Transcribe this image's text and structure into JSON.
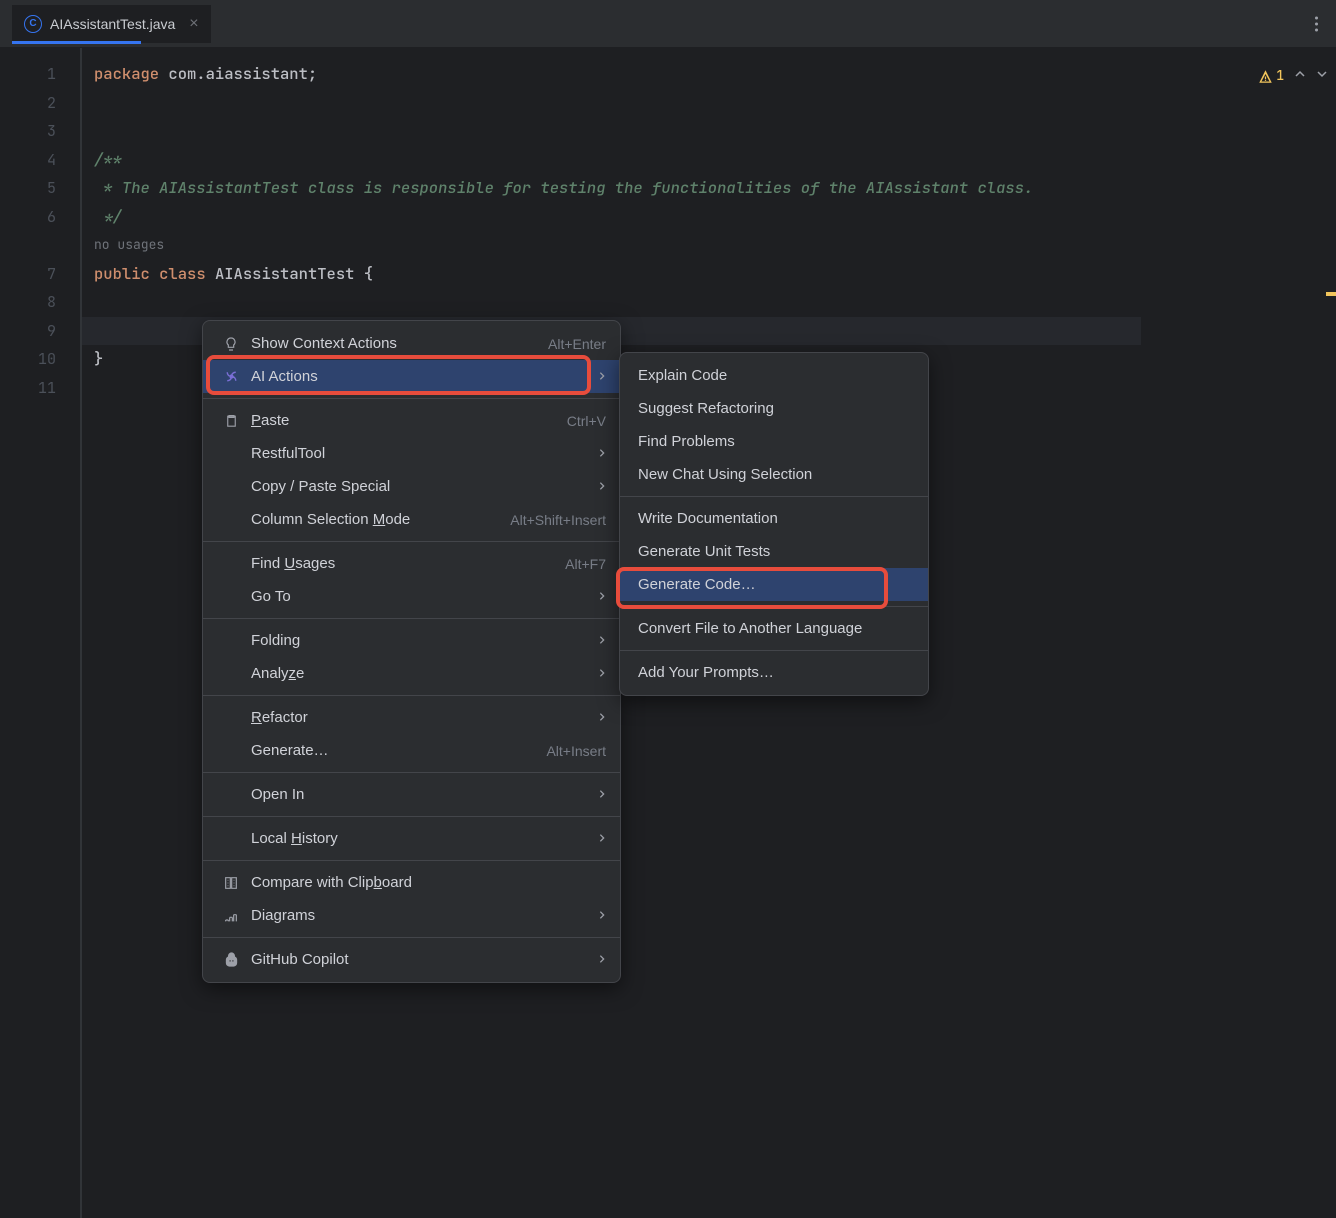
{
  "tab": {
    "name": "AIAssistantTest.java"
  },
  "status": {
    "warnings": "1"
  },
  "code": {
    "line1_kw": "package",
    "line1_rest": " com.aiassistant;",
    "line4": "/**",
    "line5": " * The AIAssistantTest class is responsible for testing the functionalities of the AIAssistant class.",
    "line6": " */",
    "usages": "no usages",
    "line7_kw1": "public",
    "line7_kw2": "class",
    "line7_name": "AIAssistantTest",
    "line7_brace": " {",
    "line10": "}"
  },
  "lineNumbers": [
    "1",
    "2",
    "3",
    "4",
    "5",
    "6",
    "",
    "7",
    "8",
    "9",
    "10",
    "11"
  ],
  "menu1": {
    "items": [
      {
        "icon": "bulb",
        "label": "Show Context Actions",
        "shortcut": "Alt+Enter"
      },
      {
        "icon": "spiral",
        "label": "AI Actions",
        "arrow": true,
        "hovered": true
      },
      "sep",
      {
        "icon": "clipboard",
        "label_pre": "",
        "underline": "P",
        "label_post": "aste",
        "shortcut": "Ctrl+V"
      },
      {
        "label": "RestfulTool",
        "arrow": true
      },
      {
        "label": "Copy / Paste Special",
        "arrow": true
      },
      {
        "label_pre": "Column Selection ",
        "underline": "M",
        "label_post": "ode",
        "shortcut": "Alt+Shift+Insert"
      },
      "sep",
      {
        "label_pre": "Find ",
        "underline": "U",
        "label_post": "sages",
        "shortcut": "Alt+F7"
      },
      {
        "label": "Go To",
        "arrow": true
      },
      "sep",
      {
        "label": "Folding",
        "arrow": true
      },
      {
        "label_pre": "Analy",
        "underline": "z",
        "label_post": "e",
        "arrow": true
      },
      "sep",
      {
        "label_pre": "",
        "underline": "R",
        "label_post": "efactor",
        "arrow": true
      },
      {
        "label": "Generate…",
        "shortcut": "Alt+Insert"
      },
      "sep",
      {
        "label": "Open In",
        "arrow": true
      },
      "sep",
      {
        "label_pre": "Local ",
        "underline": "H",
        "label_post": "istory",
        "arrow": true
      },
      "sep",
      {
        "icon": "compare",
        "label_pre": "Compare with Clip",
        "underline": "b",
        "label_post": "oard"
      },
      {
        "icon": "diagram",
        "label": "Diagrams",
        "arrow": true
      },
      "sep",
      {
        "icon": "copilot",
        "label": "GitHub Copilot",
        "arrow": true
      }
    ]
  },
  "menu2": {
    "items": [
      {
        "label": "Explain Code"
      },
      {
        "label": "Suggest Refactoring"
      },
      {
        "label": "Find Problems"
      },
      {
        "label": "New Chat Using Selection"
      },
      "sep",
      {
        "label": "Write Documentation"
      },
      {
        "label": "Generate Unit Tests"
      },
      {
        "label": "Generate Code…",
        "hovered": true
      },
      "sep",
      {
        "label": "Convert File to Another Language"
      },
      "sep",
      {
        "label": "Add Your Prompts…"
      }
    ]
  }
}
